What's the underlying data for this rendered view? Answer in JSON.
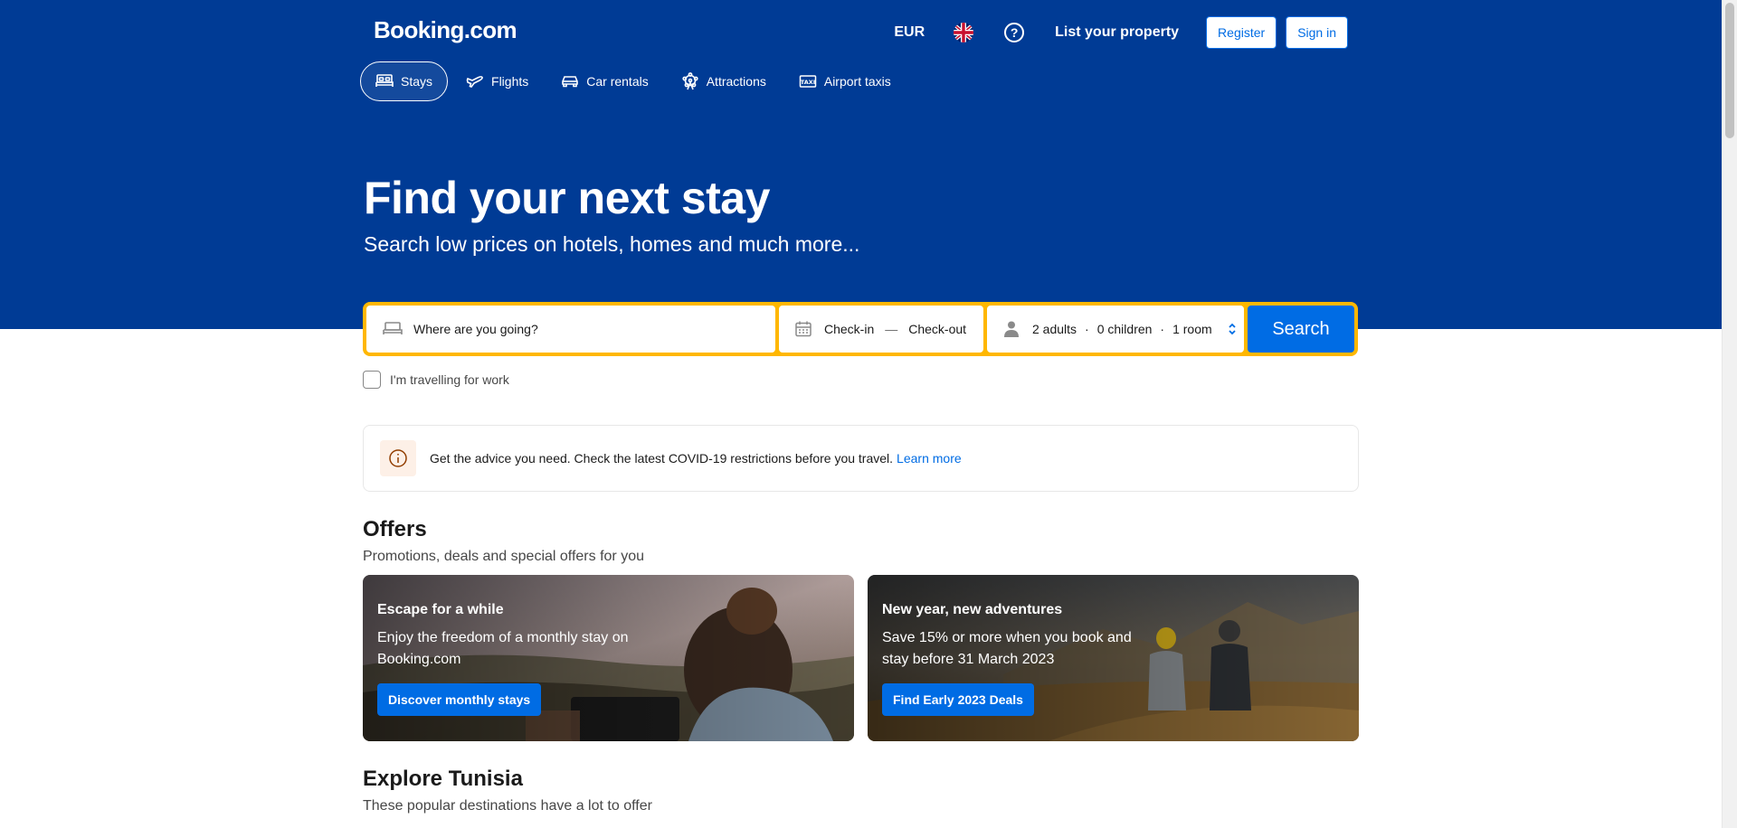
{
  "header": {
    "logo": "Booking.com",
    "currency": "EUR",
    "list_property": "List your property",
    "register": "Register",
    "sign_in": "Sign in"
  },
  "nav": {
    "items": [
      {
        "label": "Stays",
        "icon": "bed-icon",
        "active": true
      },
      {
        "label": "Flights",
        "icon": "plane-icon"
      },
      {
        "label": "Car rentals",
        "icon": "car-icon"
      },
      {
        "label": "Attractions",
        "icon": "ferris-wheel-icon"
      },
      {
        "label": "Airport taxis",
        "icon": "taxi-icon"
      }
    ]
  },
  "hero": {
    "title": "Find your next stay",
    "subtitle": "Search low prices on hotels, homes and much more..."
  },
  "search": {
    "destination_placeholder": "Where are you going?",
    "check_in": "Check-in",
    "dash": "—",
    "check_out": "Check-out",
    "adults": "2 adults",
    "children": "0 children",
    "rooms": "1 room",
    "button": "Search",
    "work_label": "I'm travelling for work"
  },
  "covid": {
    "text": "Get the advice you need. Check the latest COVID-19 restrictions before you travel.",
    "link": "Learn more"
  },
  "offers": {
    "title": "Offers",
    "subtitle": "Promotions, deals and special offers for you",
    "cards": [
      {
        "title": "Escape for a while",
        "desc": "Enjoy the freedom of a monthly stay on Booking.com",
        "button": "Discover monthly stays"
      },
      {
        "title": "New year, new adventures",
        "desc": "Save 15% or more when you book and stay before 31 March 2023",
        "button": "Find Early 2023 Deals"
      }
    ]
  },
  "explore": {
    "title": "Explore Tunisia",
    "subtitle": "These popular destinations have a lot to offer"
  },
  "colors": {
    "brand_blue": "#003b95",
    "action_blue": "#006ce4",
    "search_border": "#ffb700"
  }
}
